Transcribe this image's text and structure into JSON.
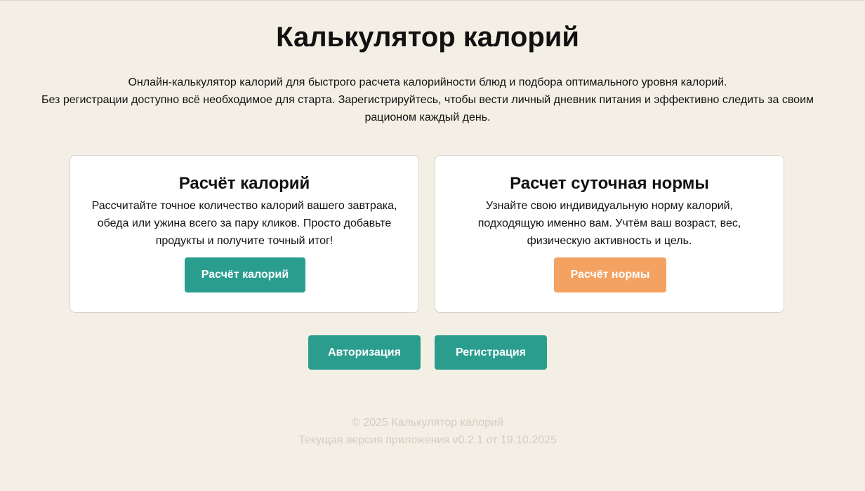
{
  "header": {
    "title": "Калькулятор калорий"
  },
  "intro": {
    "line1": "Онлайн-калькулятор калорий для быстрого расчета калорийности блюд и подбора оптимального уровня калорий.",
    "line2": "Без регистрации доступно всё необходимое для старта. Зарегистрируйтесь, чтобы вести личный дневник питания и эффективно следить за своим рационом каждый день."
  },
  "cards": [
    {
      "title": "Расчёт калорий",
      "text": "Рассчитайте точное количество калорий вашего завтрака, обеда или ужина всего за пару кликов. Просто добавьте продукты и получите точный итог!",
      "button_label": "Расчёт калорий",
      "button_color": "#2a9d8f"
    },
    {
      "title": "Расчет суточная нормы",
      "text": "Узнайте свою индивидуальную норму калорий, подходящую именно вам. Учтём ваш возраст, вес, физическую активность и цель.",
      "button_label": "Расчёт нормы",
      "button_color": "#f4a261"
    }
  ],
  "auth": {
    "login_label": "Авторизация",
    "register_label": "Регистрация",
    "button_color": "#2a9d8f"
  },
  "footer": {
    "copyright": "© 2025 Калькулятор калорий",
    "version": "Текущая версия приложения v0.2.1 от 19.10.2025"
  },
  "colors": {
    "background": "#f4efe4",
    "footer_text": "#d2cdc2"
  }
}
